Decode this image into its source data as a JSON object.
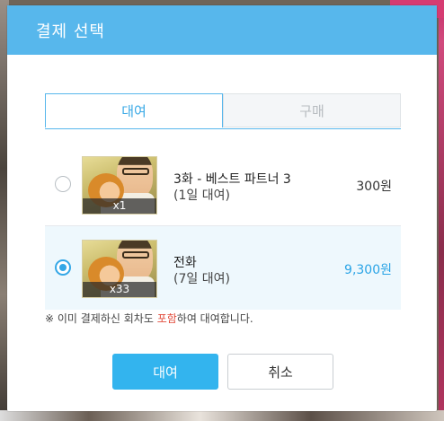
{
  "dialog": {
    "title": "결제 선택",
    "tabs": [
      {
        "label": "대여",
        "active": true
      },
      {
        "label": "구매",
        "active": false
      }
    ],
    "items": [
      {
        "title": "3화 - 베스트 파트너 3",
        "duration": "(1일 대여)",
        "price": "300원",
        "count": "x1",
        "selected": false
      },
      {
        "title": "전화",
        "duration": "(7일 대여)",
        "price": "9,300원",
        "count": "x33",
        "selected": true
      }
    ],
    "notice": {
      "prefix": "※ 이미 결제하신 회차도 ",
      "highlight": "포함",
      "suffix": "하여 대여합니다."
    },
    "buttons": {
      "confirm": "대여",
      "cancel": "취소"
    },
    "colors": {
      "header": "#57b7ec",
      "accent": "#33b4ee",
      "highlight": "#e24b3b"
    }
  }
}
